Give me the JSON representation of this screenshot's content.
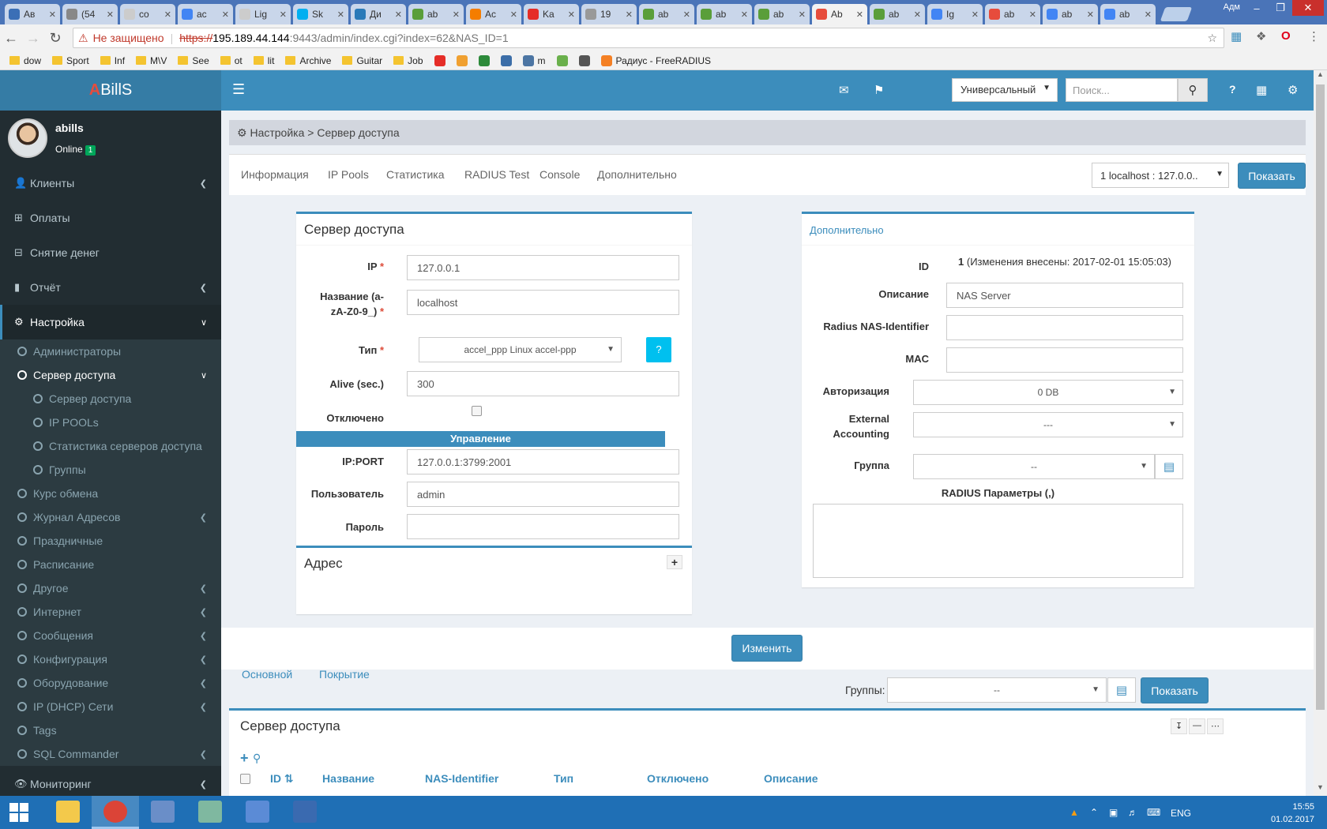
{
  "browser": {
    "tabs": [
      {
        "title": "Ав",
        "color": "#3b6fb6"
      },
      {
        "title": "(54",
        "color": "#888888"
      },
      {
        "title": "co",
        "color": "#cccccc"
      },
      {
        "title": "ac",
        "color": "#4285f4"
      },
      {
        "title": "Lig",
        "color": "#cccccc"
      },
      {
        "title": "Sk",
        "color": "#00aff0"
      },
      {
        "title": "Ди",
        "color": "#2a7ab8"
      },
      {
        "title": "ab",
        "color": "#5a9e3a"
      },
      {
        "title": "Ac",
        "color": "#f57d00"
      },
      {
        "title": "Ka",
        "color": "#e52d27"
      },
      {
        "title": "19",
        "color": "#999999"
      },
      {
        "title": "ab",
        "color": "#5a9e3a"
      },
      {
        "title": "ab",
        "color": "#5a9e3a"
      },
      {
        "title": "ab",
        "color": "#5a9e3a"
      },
      {
        "title": "Ab",
        "color": "#e74c3c",
        "active": true
      },
      {
        "title": "ab",
        "color": "#5a9e3a"
      },
      {
        "title": "Ig",
        "color": "#4285f4"
      },
      {
        "title": "ab",
        "color": "#e74c3c"
      },
      {
        "title": "ab",
        "color": "#4285f4"
      },
      {
        "title": "ab",
        "color": "#4285f4"
      }
    ],
    "user_label": "Адм",
    "security_text": "Не защищено",
    "url_scheme": "https://",
    "url_host": "195.189.44.144",
    "url_path": ":9443/admin/index.cgi?index=62&NAS_ID=1",
    "bookmarks": [
      {
        "label": "dow",
        "type": "folder"
      },
      {
        "label": "Sport",
        "type": "folder"
      },
      {
        "label": "Inf",
        "type": "folder"
      },
      {
        "label": "M\\V",
        "type": "folder"
      },
      {
        "label": "See",
        "type": "folder"
      },
      {
        "label": "ot",
        "type": "folder"
      },
      {
        "label": "lit",
        "type": "folder"
      },
      {
        "label": "Archive",
        "type": "folder"
      },
      {
        "label": "Guitar",
        "type": "folder"
      },
      {
        "label": "Job",
        "type": "folder"
      },
      {
        "label": "",
        "type": "icon",
        "color": "#e52d27"
      },
      {
        "label": "",
        "type": "icon",
        "color": "#f0a030"
      },
      {
        "label": "",
        "type": "icon",
        "color": "#2c8a3a"
      },
      {
        "label": "",
        "type": "icon",
        "color": "#3c6ea8"
      },
      {
        "label": "m",
        "type": "icon",
        "color": "#4c75a3"
      },
      {
        "label": "",
        "type": "icon",
        "color": "#6ab04c"
      },
      {
        "label": "",
        "type": "icon",
        "color": "#555555"
      },
      {
        "label": "Радиус - FreeRADIUS",
        "type": "icon",
        "color": "#f48024"
      }
    ]
  },
  "app": {
    "logo_a": "A",
    "logo_rest": "BillS",
    "theme_select": "Универсальный",
    "search_placeholder": "Поиск...",
    "help_icon": "?"
  },
  "sidebar": {
    "username": "abills",
    "status": "Online",
    "status_count": "1",
    "top_items": [
      {
        "label": "Клиенты",
        "icon": "👤",
        "arrow": true
      },
      {
        "label": "Оплаты",
        "icon": "⊞",
        "arrow": false
      },
      {
        "label": "Снятие денег",
        "icon": "⊟",
        "arrow": false
      },
      {
        "label": "Отчёт",
        "icon": "▮",
        "arrow": true
      }
    ],
    "active_item": {
      "label": "Настройка",
      "icon": "⚙"
    },
    "sub_items": [
      {
        "label": "Администраторы",
        "level": 1,
        "arrow": false
      },
      {
        "label": "Сервер доступа",
        "level": 1,
        "arrow": true,
        "open": true
      },
      {
        "label": "Сервер доступа",
        "level": 2,
        "arrow": false
      },
      {
        "label": "IP POOLs",
        "level": 2,
        "arrow": false
      },
      {
        "label": "Статистика серверов доступа",
        "level": 2,
        "arrow": false
      },
      {
        "label": "Группы",
        "level": 2,
        "arrow": false
      },
      {
        "label": "Курс обмена",
        "level": 1,
        "arrow": false
      },
      {
        "label": "Журнал Адресов",
        "level": 1,
        "arrow": true
      },
      {
        "label": "Праздничные",
        "level": 1,
        "arrow": false
      },
      {
        "label": "Расписание",
        "level": 1,
        "arrow": false
      },
      {
        "label": "Другое",
        "level": 1,
        "arrow": true
      },
      {
        "label": "Интернет",
        "level": 1,
        "arrow": true
      },
      {
        "label": "Сообщения",
        "level": 1,
        "arrow": true
      },
      {
        "label": "Конфигурация",
        "level": 1,
        "arrow": true
      },
      {
        "label": "Оборудование",
        "level": 1,
        "arrow": true
      },
      {
        "label": "IP (DHCP) Сети",
        "level": 1,
        "arrow": true
      },
      {
        "label": "Tags",
        "level": 1,
        "arrow": false
      },
      {
        "label": "SQL Commander",
        "level": 1,
        "arrow": true
      }
    ],
    "bottom_item": {
      "label": "Мониторинг",
      "icon": "👁"
    }
  },
  "breadcrumb": {
    "root": "Настройка",
    "separator": ">",
    "current": "Сервер доступа"
  },
  "tabs": {
    "items": [
      "Информация",
      "IP Pools",
      "Статистика",
      "RADIUS Test",
      "Console",
      "Дополнительно"
    ],
    "nas_select": "1 localhost : 127.0.0..",
    "show_button": "Показать"
  },
  "nas_form": {
    "title": "Сервер доступа",
    "ip_label": "IP",
    "ip_value": "127.0.0.1",
    "name_label_1": "Название (a-",
    "name_label_2": "zA-Z0-9_)",
    "name_value": "localhost",
    "type_label": "Тип",
    "type_value": "accel_ppp Linux accel-ppp",
    "help_label": "?",
    "alive_label": "Alive (sec.)",
    "alive_value": "300",
    "disabled_label": "Отключено",
    "control_header": "Управление",
    "ipport_label": "IP:PORT",
    "ipport_value": "127.0.0.1:3799:2001",
    "user_label": "Пользователь",
    "user_value": "admin",
    "password_label": "Пароль",
    "password_value": "",
    "address_title": "Адрес",
    "expand_icon": "+"
  },
  "extra_form": {
    "title": "Дополнительно",
    "id_label": "ID",
    "id_value": "1",
    "id_changed": "(Изменения внесены: 2017-02-01 15:05:03)",
    "desc_label": "Описание",
    "desc_value": "NAS Server",
    "radius_id_label": "Radius NAS-Identifier",
    "radius_id_value": "",
    "mac_label": "MAC",
    "mac_value": "",
    "auth_label": "Авторизация",
    "auth_value": "0 DB",
    "ext_acc_label_1": "External",
    "ext_acc_label_2": "Accounting",
    "ext_acc_value": "---",
    "group_label": "Группа",
    "group_value": "--",
    "radius_params_label": "RADIUS Параметры (,)"
  },
  "change_button": "Изменить",
  "bottom_tabs": {
    "items": [
      "Основной",
      "Покрытие"
    ],
    "groups_label": "Группы:",
    "groups_value": "--",
    "show_button": "Показать"
  },
  "list": {
    "title": "Сервер доступа",
    "columns": [
      "ID",
      "Название",
      "NAS-Identifier",
      "Тип",
      "Отключено",
      "Описание"
    ]
  },
  "taskbar": {
    "apps": [
      {
        "name": "file-explorer",
        "color": "#f3c94b"
      },
      {
        "name": "chrome",
        "color": "#db4437",
        "active": true
      },
      {
        "name": "network-tool",
        "color": "#6a8ec8"
      },
      {
        "name": "server-manager",
        "color": "#7fb8a0"
      },
      {
        "name": "remote-desktop",
        "color": "#5b8bd6"
      },
      {
        "name": "remote-connection",
        "color": "#3a6ab0"
      }
    ],
    "lang": "ENG",
    "time": "15:55",
    "date": "01.02.2017"
  }
}
